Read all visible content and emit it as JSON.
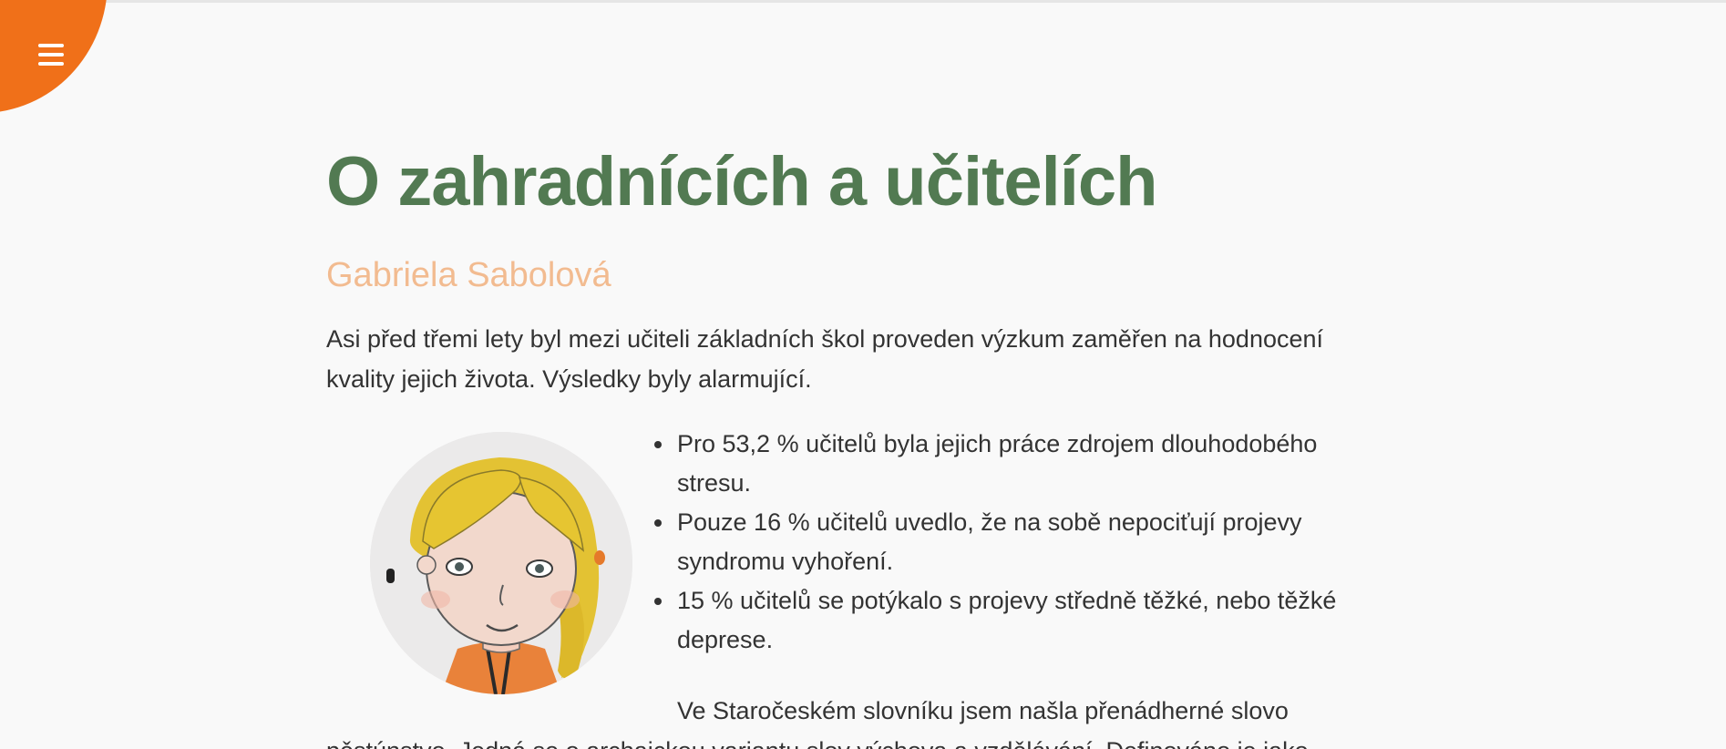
{
  "menu": {
    "icon": "hamburger-icon",
    "color": "#f07019"
  },
  "article": {
    "title": "O zahradnících a učitelích",
    "author": "Gabriela Sabolová",
    "intro": "Asi před třemi lety byl mezi učiteli základních škol proveden výzkum zaměřen na hodnocení kvality jejich života. Výsledky byly alarmující.",
    "portrait": "hand-drawn-portrait",
    "findings": [
      "Pro 53,2 % učitelů byla jejich práce zdrojem dlouhodobého stresu.",
      "Pouze 16 % učitelů uvedlo, že na sobě nepociťují projevy syndromu vyhoření.",
      "15 % učitelů se potýkalo s projevy středně těžké, nebo těžké deprese."
    ],
    "paragraph": "Ve Staročeském slovníku jsem našla přenádherné slovo pěstúnstvo. Jedná se o archaickou variantu slov výchova a vzdělávání. Definováno je jako"
  },
  "colors": {
    "title": "#527a52",
    "author": "#f2bb90",
    "accent": "#f07019",
    "background": "#f9f9f9"
  }
}
